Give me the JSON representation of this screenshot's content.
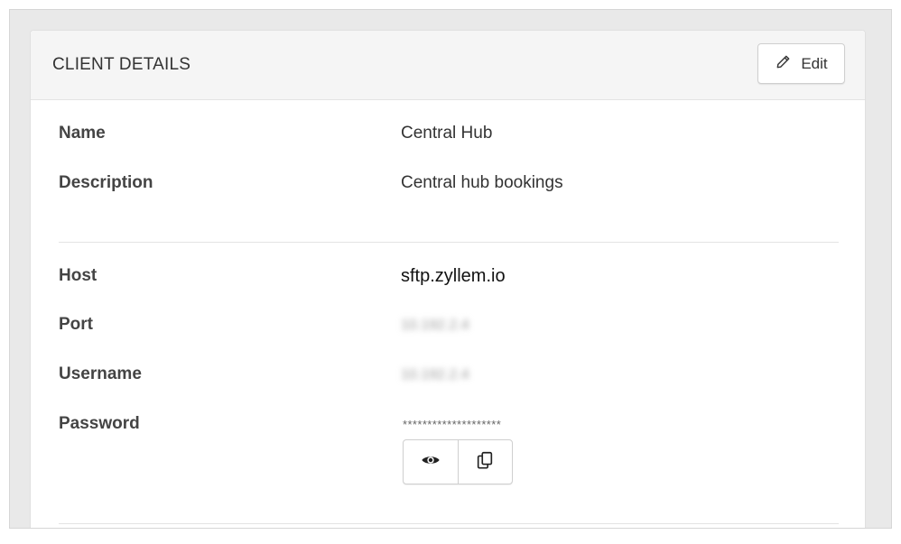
{
  "card": {
    "title": "CLIENT DETAILS",
    "edit_label": "Edit"
  },
  "client": {
    "name_label": "Name",
    "name_value": "Central Hub",
    "description_label": "Description",
    "description_value": "Central hub bookings"
  },
  "connection": {
    "host_label": "Host",
    "host_value": "sftp.zyllem.io",
    "port_label": "Port",
    "port_value": "10.192.2.4",
    "username_label": "Username",
    "username_value": "10.192.2.4",
    "password_label": "Password",
    "password_masked": "********************",
    "show_password_icon": "eye-icon",
    "copy_password_icon": "copy-icon"
  }
}
